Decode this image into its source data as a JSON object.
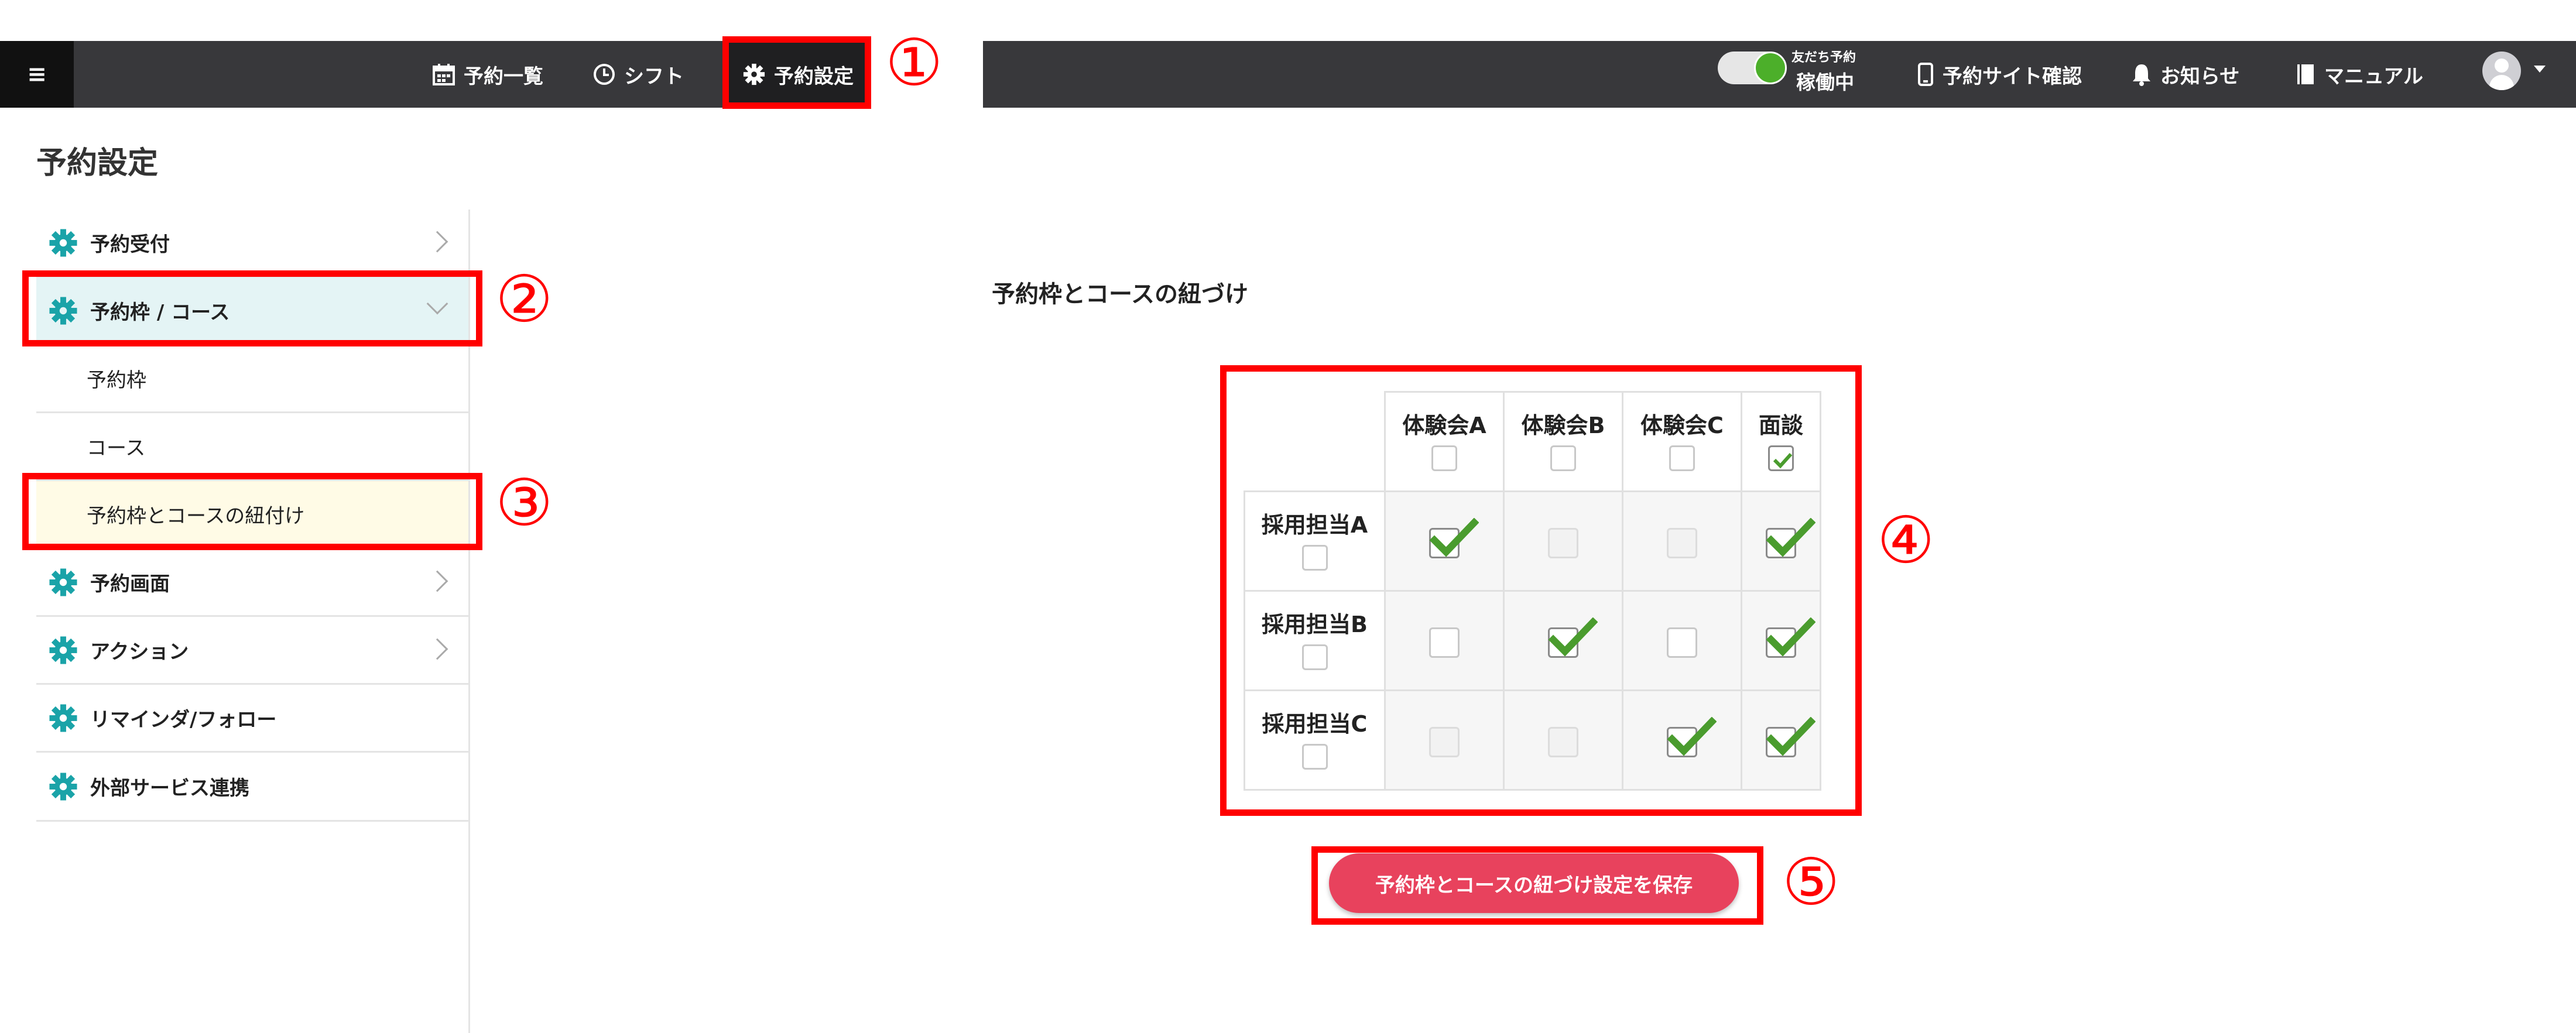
{
  "topbar": {
    "menu_icon": "hamburger-icon",
    "nav": [
      {
        "label": "予約一覧",
        "icon": "calendar-icon"
      },
      {
        "label": "シフト",
        "icon": "clock-icon"
      },
      {
        "label": "予約設定",
        "icon": "gear-icon"
      }
    ],
    "toggle_caption": "友だち予約",
    "toggle_status": "稼働中",
    "right": [
      {
        "label": "予約サイト確認",
        "icon": "phone-icon"
      },
      {
        "label": "お知らせ",
        "icon": "bell-icon"
      },
      {
        "label": "マニュアル",
        "icon": "book-icon"
      }
    ],
    "background": "#38383b"
  },
  "page": {
    "title": "予約設定"
  },
  "sidebar": {
    "items": [
      {
        "label": "予約受付"
      },
      {
        "label": "予約枠 / コース"
      },
      {
        "label": "予約枠"
      },
      {
        "label": "コース"
      },
      {
        "label": "予約枠とコースの紐付け"
      },
      {
        "label": "予約画面"
      },
      {
        "label": "アクション"
      },
      {
        "label": "リマインダ/フォロー"
      },
      {
        "label": "外部サービス連携"
      }
    ],
    "accent": "#1aa3a8"
  },
  "main": {
    "section_title": "予約枠とコースの紐づけ",
    "columns": [
      "体験会A",
      "体験会B",
      "体験会C",
      "面談"
    ],
    "column_checked": [
      false,
      false,
      false,
      true
    ],
    "rows": [
      "採用担当A",
      "採用担当B",
      "採用担当C"
    ],
    "cells": [
      [
        "checked",
        "disabled",
        "disabled",
        "checked"
      ],
      [
        "empty",
        "checked",
        "empty",
        "checked"
      ],
      [
        "disabled",
        "disabled",
        "checked",
        "checked"
      ]
    ],
    "save_label": "予約枠とコースの紐づけ設定を保存",
    "save_color": "#e8425d",
    "check_color": "#4a9c2e"
  },
  "annotations": {
    "markers": [
      "①",
      "②",
      "③",
      "④",
      "⑤"
    ],
    "color": "#ff0000"
  }
}
